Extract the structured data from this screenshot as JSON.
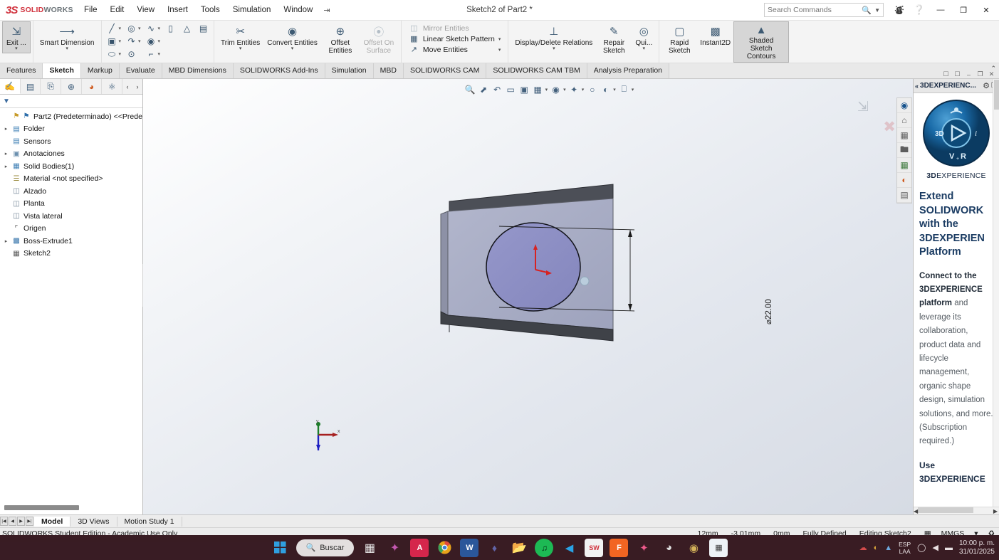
{
  "titlebar": {
    "logo_text_a": "3S",
    "logo_name_a": "SOLID",
    "logo_name_b": "WORKS",
    "menus": [
      "File",
      "Edit",
      "View",
      "Insert",
      "Tools",
      "Simulation",
      "Window"
    ],
    "pin_glyph": "⇥",
    "document_title": "Sketch2 of Part2 *",
    "search_placeholder": "Search Commands",
    "search_value": "",
    "icons": {
      "account": "account-icon",
      "help": "help-icon"
    },
    "window_buttons": {
      "minimize": "—",
      "restore": "❐",
      "close": "✕"
    }
  },
  "ribbon": {
    "groups": [
      {
        "name": "exit",
        "buttons": [
          {
            "label": "Exit ...",
            "icon": "exit-sketch-icon",
            "caret": true,
            "active": true
          }
        ]
      },
      {
        "name": "smart-dimension",
        "buttons": [
          {
            "label": "Smart Dimension",
            "icon": "smart-dimension-icon",
            "caret": true
          }
        ]
      }
    ],
    "sketch_tools": [
      {
        "name": "line-icon",
        "glyph": "╱",
        "caret": true
      },
      {
        "name": "circle-icon",
        "glyph": "◎",
        "caret": true
      },
      {
        "name": "spline-icon",
        "glyph": "∿",
        "caret": true
      },
      {
        "name": "text-icon",
        "glyph": "▯",
        "caret": false,
        "dim": true
      },
      {
        "name": "rectangle-icon",
        "glyph": "▣",
        "caret": true
      },
      {
        "name": "arc-icon",
        "glyph": "↷",
        "caret": true
      },
      {
        "name": "perimeter-circle-icon",
        "glyph": "◉",
        "caret": true
      },
      {
        "name": "point-icon",
        "glyph": "△",
        "caret": false
      },
      {
        "name": "slot-icon",
        "glyph": "⬭",
        "caret": true
      },
      {
        "name": "polygon-icon",
        "glyph": "⊙",
        "caret": false
      },
      {
        "name": "fillet-icon",
        "glyph": "⌐",
        "caret": true
      },
      {
        "name": "construction-geometry-icon",
        "glyph": "▤",
        "caret": false
      }
    ],
    "trim_group": [
      {
        "label": "Trim Entities",
        "icon": "trim-entities-icon",
        "caret": true
      },
      {
        "label": "Convert Entities",
        "icon": "convert-entities-icon",
        "caret": true
      },
      {
        "label": "Offset Entities",
        "icon": "offset-entities-icon",
        "caret": false
      },
      {
        "label": "Offset On Surface",
        "icon": "offset-on-surface-icon",
        "caret": false,
        "dim": true
      }
    ],
    "pattern_list": [
      {
        "label": "Mirror Entities",
        "icon": "mirror-entities-icon",
        "dim": true
      },
      {
        "label": "Linear Sketch Pattern",
        "icon": "linear-sketch-pattern-icon",
        "caret": true
      },
      {
        "label": "Move Entities",
        "icon": "move-entities-icon",
        "caret": true
      }
    ],
    "relations": [
      {
        "label": "Display/Delete Relations",
        "icon": "display-delete-relations-icon",
        "caret": true
      },
      {
        "label": "Repair Sketch",
        "icon": "repair-sketch-icon",
        "caret": false
      },
      {
        "label": "Qui...",
        "icon": "quick-snaps-icon",
        "caret": true
      }
    ],
    "modes": [
      {
        "label": "Rapid Sketch",
        "icon": "rapid-sketch-icon"
      },
      {
        "label": "Instant2D",
        "icon": "instant2d-icon"
      },
      {
        "label": "Shaded Sketch Contours",
        "icon": "shaded-sketch-contours-icon",
        "active": true
      }
    ],
    "collapse_glyph": "⌃"
  },
  "tabs": {
    "items": [
      "Features",
      "Sketch",
      "Markup",
      "Evaluate",
      "MBD Dimensions",
      "SOLIDWORKS Add-Ins",
      "Simulation",
      "MBD",
      "SOLIDWORKS CAM",
      "SOLIDWORKS CAM TBM",
      "Analysis Preparation"
    ],
    "selected": "Sketch",
    "window_tools": [
      "restore-down-icon",
      "maximize-icon",
      "minimize-icon",
      "restore-icon",
      "close-icon"
    ]
  },
  "feature_manager": {
    "tabs": [
      {
        "name": "feature-manager-tab",
        "glyph": "✍",
        "selected": true
      },
      {
        "name": "property-manager-tab",
        "glyph": "▤"
      },
      {
        "name": "configuration-manager-tab",
        "glyph": "⎘"
      },
      {
        "name": "dimxpert-manager-tab",
        "glyph": "⊕"
      },
      {
        "name": "display-manager-tab",
        "glyph": "◕"
      },
      {
        "name": "addins-manager-tab",
        "glyph": "⚛"
      }
    ],
    "nav": [
      "‹",
      "›"
    ],
    "filter_placeholder": "",
    "tree": [
      {
        "label": "Part2 (Predeterminado) <<Prede",
        "icon": "part-icon",
        "arrow": false,
        "root": true
      },
      {
        "label": "Folder",
        "icon": "folder-icon",
        "arrow": true
      },
      {
        "label": "Sensors",
        "icon": "sensors-icon",
        "arrow": false
      },
      {
        "label": "Anotaciones",
        "icon": "annotations-icon",
        "arrow": true
      },
      {
        "label": "Solid Bodies(1)",
        "icon": "solid-bodies-icon",
        "arrow": true
      },
      {
        "label": "Material <not specified>",
        "icon": "material-icon",
        "arrow": false
      },
      {
        "label": "Alzado",
        "icon": "plane-icon",
        "arrow": false
      },
      {
        "label": "Planta",
        "icon": "plane-icon",
        "arrow": false
      },
      {
        "label": "Vista lateral",
        "icon": "plane-icon",
        "arrow": false
      },
      {
        "label": "Origen",
        "icon": "origin-icon",
        "arrow": false
      },
      {
        "label": "Boss-Extrude1",
        "icon": "boss-extrude-icon",
        "arrow": true
      },
      {
        "label": "Sketch2",
        "icon": "sketch-icon",
        "arrow": false
      }
    ]
  },
  "graphics": {
    "heads_up": [
      {
        "name": "zoom-to-fit-icon",
        "glyph": "🔎"
      },
      {
        "name": "zoom-to-area-icon",
        "glyph": "⤢"
      },
      {
        "name": "previous-view-icon",
        "glyph": "↩"
      },
      {
        "name": "section-view-icon",
        "glyph": "▥"
      },
      {
        "name": "view-orientation-icon",
        "glyph": "⬓"
      },
      {
        "name": "display-style-icon",
        "glyph": "▣",
        "caret": true
      },
      {
        "name": "hide-show-items-icon",
        "glyph": "◍",
        "caret": true
      },
      {
        "name": "edit-appearance-icon",
        "glyph": "✦",
        "caret": true
      },
      {
        "name": "apply-scene-icon",
        "glyph": "◯",
        "caret": true
      },
      {
        "name": "view-settings-icon",
        "glyph": "◐",
        "caret": true
      },
      {
        "name": "viewport-icon",
        "glyph": "🖵",
        "caret": true
      }
    ],
    "confirm_corner": {
      "accept": "exit-sketch-icon",
      "cancel": "cancel-icon"
    },
    "dimension_label": "⌀22.00",
    "triad_labels": {
      "x": "x",
      "y": "y"
    },
    "task_pane_icons": [
      {
        "name": "3dexperience-icon",
        "glyph": "🌐"
      },
      {
        "name": "solidworks-resources-icon",
        "glyph": "⌂"
      },
      {
        "name": "design-library-icon",
        "glyph": "📚"
      },
      {
        "name": "file-explorer-icon",
        "glyph": "🗀"
      },
      {
        "name": "view-palette-icon",
        "glyph": "🖼"
      },
      {
        "name": "appearances-scenes-icon",
        "glyph": "◕"
      },
      {
        "name": "custom-properties-icon",
        "glyph": "▤"
      }
    ]
  },
  "task_pane": {
    "title": "3DEXPERIENC...",
    "collapse_glyph": "«",
    "gear": "gear-icon",
    "pin": "pin-icon",
    "brand_bold": "3D",
    "brand_rest": "EXPERIENCE",
    "compass": {
      "n": "3D",
      "e": "i",
      "s": "V+R",
      "w": ""
    },
    "heading": "Extend SOLIDWORK with the 3DEXPERIEN Platform",
    "body_bold_1": "Connect to the 3DEXPERIENCE platform",
    "body_rest": " and leverage its collaboration, product data and lifecycle management, organic shape design, simulation solutions, and more. (Subscription required.)",
    "heading_2": "Use 3DEXPERIENCE"
  },
  "doc_bar": {
    "nav_glyphs": [
      "|◀",
      "◀",
      "▶",
      "▶|"
    ],
    "tabs": [
      "Model",
      "3D Views",
      "Motion Study 1"
    ],
    "selected": "Model"
  },
  "status_bar": {
    "left": "SOLIDWORKS Student Edition - Academic Use Only",
    "metrics": [
      "12mm",
      "-3.01mm",
      "0mm",
      "Fully Defined",
      "Editing Sketch2"
    ],
    "unit_icon": "unit-icon",
    "units": "MMGS",
    "caret": "▾",
    "right_icon": "rebuild-icon"
  },
  "taskbar": {
    "start": "start-icon",
    "search_label": "Buscar",
    "search_icon": "search-icon",
    "apps": [
      {
        "name": "task-view-icon",
        "glyph": "▢",
        "color": "#d9d9d9"
      },
      {
        "name": "copilot-icon",
        "glyph": "◈",
        "color": "#c458b0"
      },
      {
        "name": "acrobat-icon",
        "glyph": "A",
        "color": "#d5264c"
      },
      {
        "name": "chrome-icon",
        "glyph": "◉",
        "color": "#e8a31a"
      },
      {
        "name": "word-icon",
        "glyph": "W",
        "color": "#2b579a"
      },
      {
        "name": "teams-icon",
        "glyph": "T",
        "color": "#6264a7"
      },
      {
        "name": "file-explorer-icon",
        "glyph": "🗀",
        "color": "#ffc861"
      },
      {
        "name": "spotify-icon",
        "glyph": "♫",
        "color": "#1db954"
      },
      {
        "name": "vscode-icon",
        "glyph": "◀",
        "color": "#29a3e5"
      },
      {
        "name": "solidworks-icon",
        "glyph": "SW",
        "color": "#d1333e"
      },
      {
        "name": "foxit-icon",
        "glyph": "F",
        "color": "#f26522"
      },
      {
        "name": "photos-icon",
        "glyph": "◆",
        "color": "#ef5a8c"
      },
      {
        "name": "clock-app-icon",
        "glyph": "◔",
        "color": "#2f3b4c"
      },
      {
        "name": "chrome-beta-icon",
        "glyph": "◉",
        "color": "#d4b25a"
      },
      {
        "name": "calculator-icon",
        "glyph": "▦",
        "color": "#e9eef3"
      }
    ],
    "tray": [
      {
        "name": "onedrive-alert-icon",
        "glyph": "☁"
      },
      {
        "name": "notification-icon",
        "glyph": "◕"
      },
      {
        "name": "arrow-up-icon",
        "glyph": "⌃"
      }
    ],
    "language": {
      "line1": "ESP",
      "line2": "LAA"
    },
    "tray2": [
      {
        "name": "wifi-icon",
        "glyph": "📶"
      },
      {
        "name": "volume-icon",
        "glyph": "🔊"
      },
      {
        "name": "battery-icon",
        "glyph": "▬"
      }
    ],
    "clock_time": "10:00 p. m.",
    "clock_date": "31/01/2025"
  },
  "colors": {
    "brand_red": "#d1333e",
    "accent_blue": "#1b3c63",
    "part_face": "#a9aec6",
    "circle_face": "#8d8fc4",
    "taskbar_bg": "#391c24"
  }
}
